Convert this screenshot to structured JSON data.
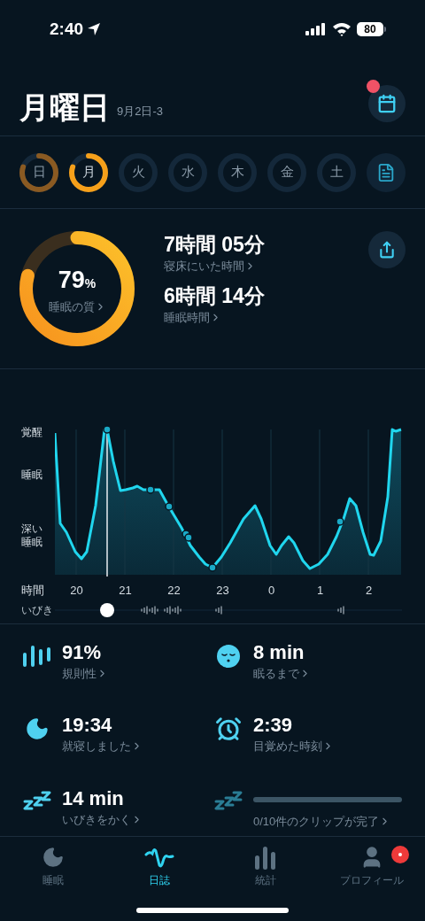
{
  "status_bar": {
    "time": "2:40",
    "battery": "80"
  },
  "header": {
    "title": "月曜日",
    "date": "9月2日-3",
    "calendar_badge": true
  },
  "days": [
    {
      "label": "日",
      "color": "#8a5a22",
      "selected": false
    },
    {
      "label": "月",
      "color": "#f6a01a",
      "selected": true
    },
    {
      "label": "火",
      "selected": false
    },
    {
      "label": "水",
      "selected": false
    },
    {
      "label": "木",
      "selected": false
    },
    {
      "label": "金",
      "selected": false
    },
    {
      "label": "土",
      "selected": false
    }
  ],
  "summary": {
    "quality": {
      "value": "79",
      "unit": "%",
      "label": "睡眠の質",
      "level": 0.79
    },
    "stats": [
      {
        "value": "7時間 05分",
        "label": "寝床にいた時間"
      },
      {
        "value": "6時間 14分",
        "label": "睡眠時間"
      }
    ]
  },
  "sleep_graph": {
    "y_labels": [
      "覚醒",
      "睡眠",
      "深い睡眠"
    ],
    "x_label": "時間",
    "x_ticks": [
      "20",
      "21",
      "22",
      "23",
      "0",
      "1",
      "2"
    ],
    "snore_label": "いびき"
  },
  "metrics": [
    {
      "kind": "regularity",
      "value": "91%",
      "label": "規則性"
    },
    {
      "kind": "asleep",
      "value": "8 min",
      "label": "眠るまで"
    },
    {
      "kind": "bedtime",
      "value": "19:34",
      "label": "就寝しました"
    },
    {
      "kind": "wake",
      "value": "2:39",
      "label": "目覚めた時刻"
    },
    {
      "kind": "snore",
      "value": "14 min",
      "label": "いびきをかく"
    },
    {
      "kind": "clips",
      "label": "0/10件のクリップが完了"
    }
  ],
  "tabs": [
    {
      "kind": "sleep",
      "label": "睡眠",
      "selected": false,
      "badge": false
    },
    {
      "kind": "journal",
      "label": "日誌",
      "selected": true,
      "badge": false
    },
    {
      "kind": "stats",
      "label": "統計",
      "selected": false,
      "badge": false
    },
    {
      "kind": "profile",
      "label": "プロフィール",
      "selected": false,
      "badge": true
    }
  ]
}
